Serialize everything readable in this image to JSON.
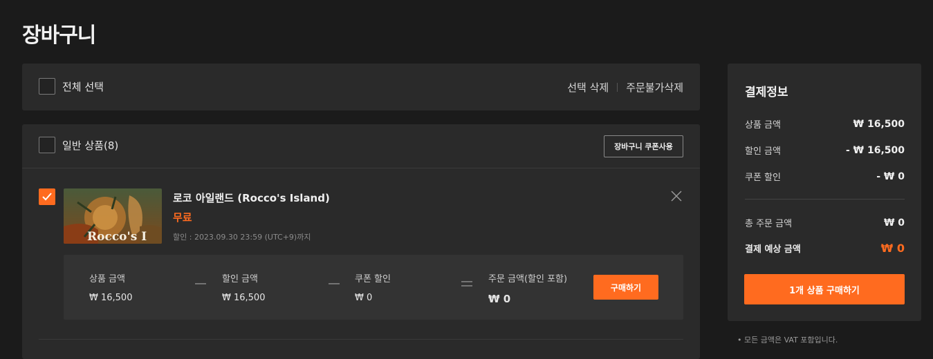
{
  "page": {
    "title": "장바구니"
  },
  "select_bar": {
    "select_all_label": "전체 선택",
    "delete_selected": "선택 삭제",
    "delete_unavailable": "주문불가삭제"
  },
  "cart": {
    "section_label": "일반 상품(8)",
    "coupon_button": "장바구니 쿠폰사용",
    "item": {
      "checked": true,
      "name": "로코 아일랜드 (Rocco's Island)",
      "price_label": "무료",
      "discount_note": "할인 : 2023.09.30 23:59 (UTC+9)까지",
      "thumbnail_text": "Rocco's I",
      "summary": {
        "product_amount_label": "상품 금액",
        "product_amount": "₩ 16,500",
        "discount_amount_label": "할인 금액",
        "discount_amount": "₩ 16,500",
        "coupon_discount_label": "쿠폰 할인",
        "coupon_discount": "₩ 0",
        "order_amount_label": "주문 금액(할인 포함)",
        "order_amount": "₩ 0",
        "buy_button": "구매하기"
      }
    }
  },
  "payment": {
    "title": "결제정보",
    "rows": [
      {
        "label": "상품 금액",
        "value": "₩ 16,500"
      },
      {
        "label": "할인 금액",
        "value": "- ₩ 16,500"
      },
      {
        "label": "쿠폰 할인",
        "value": "- ₩ 0"
      }
    ],
    "total_label": "총 주문 금액",
    "total_value": "₩ 0",
    "expected_label": "결제 예상 금액",
    "expected_value": "₩ 0",
    "buy_button": "1개 상품 구매하기",
    "vat_note": "• 모든 금액은 VAT 포함입니다."
  },
  "colors": {
    "accent": "#ff6b1f",
    "background": "#1b1b1b",
    "panel": "#2a2a2a"
  }
}
